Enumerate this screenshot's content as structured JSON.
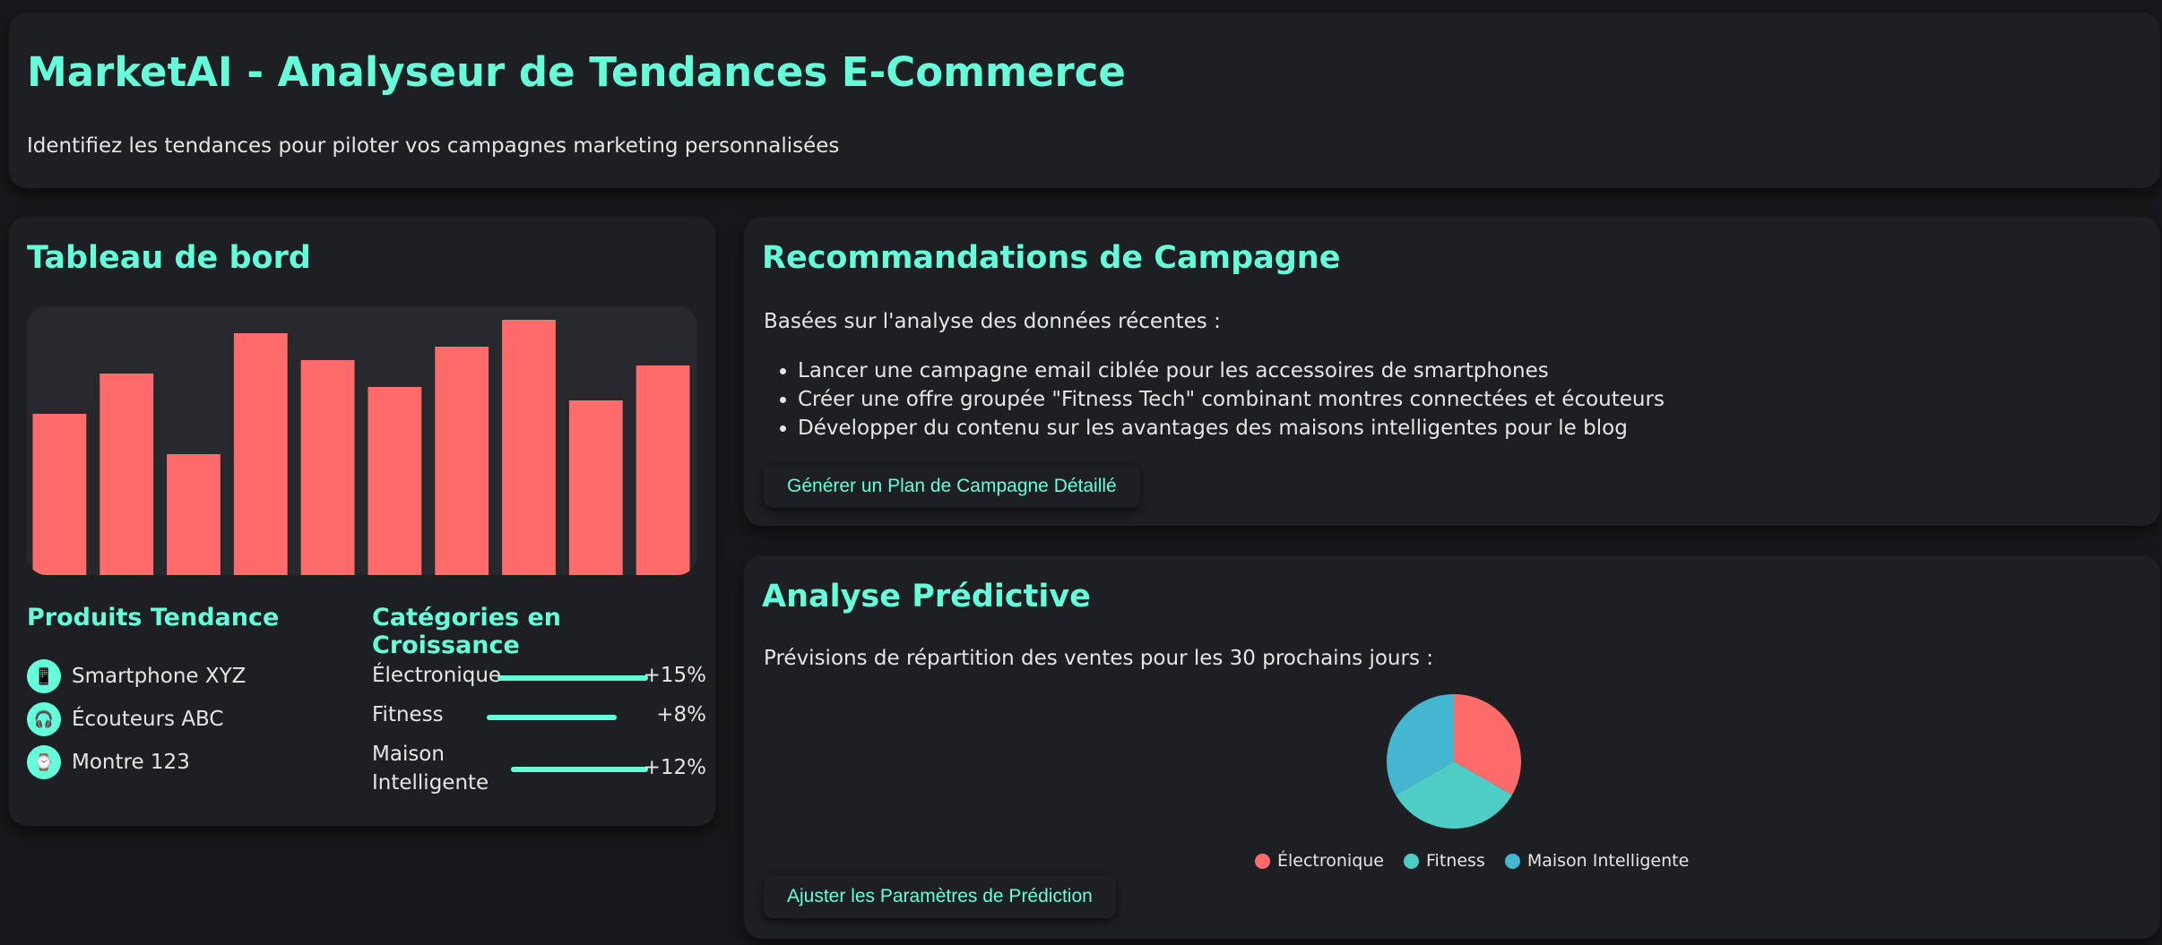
{
  "header": {
    "title": "MarketAI - Analyseur de Tendances E-Commerce",
    "subtitle": "Identifiez les tendances pour piloter vos campagnes marketing personnalisées"
  },
  "dashboard": {
    "title": "Tableau de bord",
    "products_title": "Produits Tendance",
    "products": [
      {
        "label": "Smartphone XYZ",
        "icon": "mobile-phone-icon"
      },
      {
        "label": "Écouteurs ABC",
        "icon": "headphones-icon"
      },
      {
        "label": "Montre 123",
        "icon": "watch-icon"
      }
    ],
    "categories_title": "Catégories en Croissance",
    "categories": [
      {
        "name": "Électronique",
        "pct": "+15%",
        "value": 15
      },
      {
        "name": "Fitness",
        "pct": "+8%",
        "value": 8
      },
      {
        "name": "Maison Intelligente",
        "pct": "+12%",
        "value": 12
      }
    ]
  },
  "chart_data": [
    {
      "type": "bar",
      "values": [
        60,
        75,
        45,
        90,
        80,
        70,
        85,
        95,
        65,
        78
      ],
      "ylim": [
        0,
        100
      ],
      "color": "#ff6b6b"
    },
    {
      "type": "pie",
      "categories": [
        "Électronique",
        "Fitness",
        "Maison Intelligente"
      ],
      "values": [
        33.3,
        33.3,
        33.3
      ],
      "colors": [
        "#ff6b6b",
        "#4ecdc4",
        "#45b7d1"
      ],
      "legend": "bottom"
    }
  ],
  "recommendations": {
    "title": "Recommandations de Campagne",
    "intro": "Basées sur l'analyse des données récentes :",
    "items": [
      "Lancer une campagne email ciblée pour les accessoires de smartphones",
      "Créer une offre groupée \"Fitness Tech\" combinant montres connectées et écouteurs",
      "Développer du contenu sur les avantages des maisons intelligentes pour le blog"
    ],
    "button": "Générer un Plan de Campagne Détaillé"
  },
  "predictive": {
    "title": "Analyse Prédictive",
    "intro": "Prévisions de répartition des ventes pour les 30 prochains jours :",
    "button": "Ajuster les Paramètres de Prédiction"
  },
  "colors": {
    "accent": "#64ffda",
    "background": "#17181b",
    "card": "#1e1f23"
  }
}
